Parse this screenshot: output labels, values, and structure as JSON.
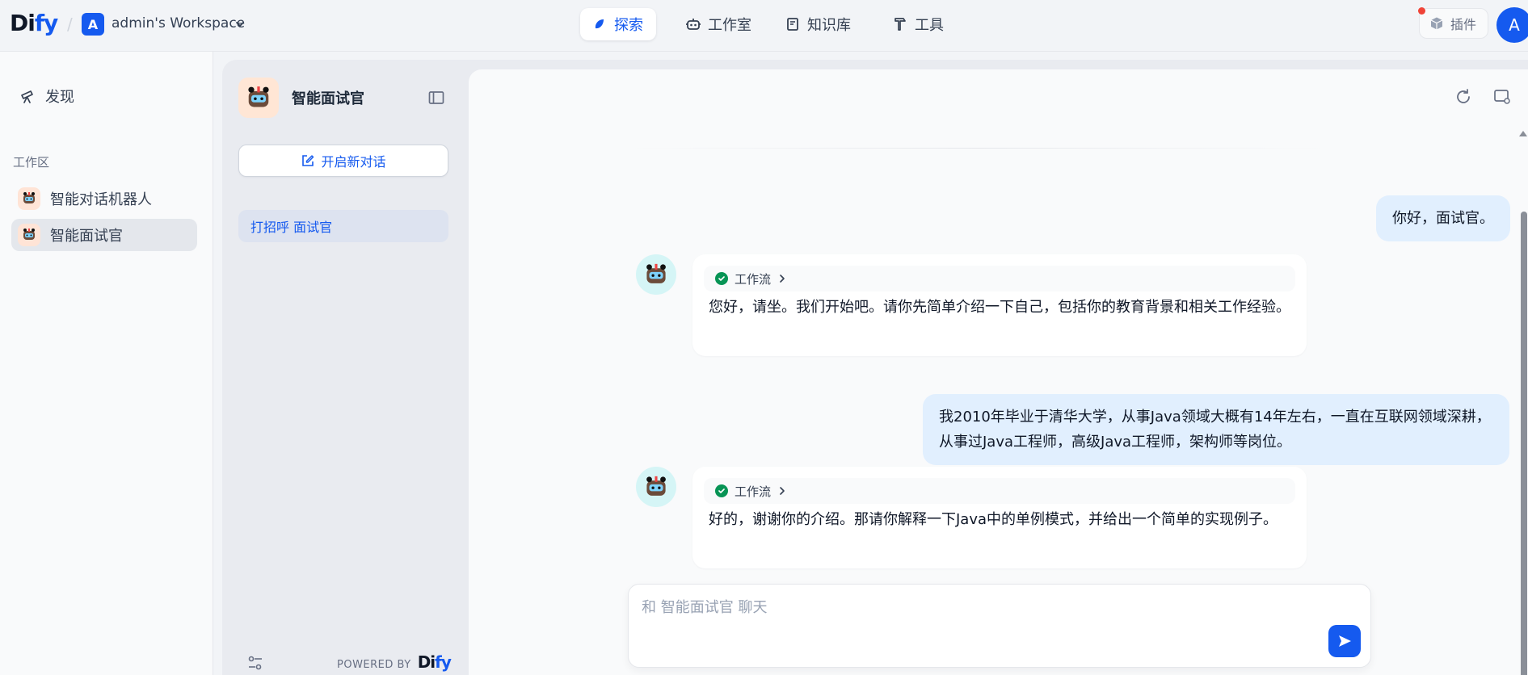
{
  "header": {
    "logo_main": "Di",
    "logo_accent": "fy",
    "workspace_initial": "A",
    "workspace_name": "admin's Workspace",
    "nav": {
      "explore": "探索",
      "studio": "工作室",
      "knowledge": "知识库",
      "tools": "工具"
    },
    "plugin_label": "插件",
    "user_initial": "A"
  },
  "sidebar": {
    "discover_label": "发现",
    "section_label": "工作区",
    "items": [
      {
        "label": "智能对话机器人",
        "active": false
      },
      {
        "label": "智能面试官",
        "active": true
      }
    ]
  },
  "chat_panel": {
    "app_name": "智能面试官",
    "new_chat_label": "开启新对话",
    "conversations": [
      {
        "label": "打招呼 面试官",
        "active": true
      }
    ],
    "powered_by": "POWERED BY",
    "powered_logo_main": "Di",
    "powered_logo_accent": "fy"
  },
  "messages": [
    {
      "role": "user",
      "text": "你好，面试官。"
    },
    {
      "role": "bot",
      "workflow": "工作流",
      "text": "您好，请坐。我们开始吧。请你先简单介绍一下自己，包括你的教育背景和相关工作经验。"
    },
    {
      "role": "user",
      "text": "我2010年毕业于清华大学，从事Java领域大概有14年左右，一直在互联网领域深耕，从事过Java工程师，高级Java工程师，架构师等岗位。"
    },
    {
      "role": "bot",
      "workflow": "工作流",
      "text": "好的，谢谢你的介绍。那请你解释一下Java中的单例模式，并给出一个简单的实现例子。"
    }
  ],
  "composer": {
    "placeholder": "和 智能面试官 聊天"
  },
  "colors": {
    "accent": "#155aef",
    "user_bubble": "#e1effe",
    "success": "#079455"
  }
}
